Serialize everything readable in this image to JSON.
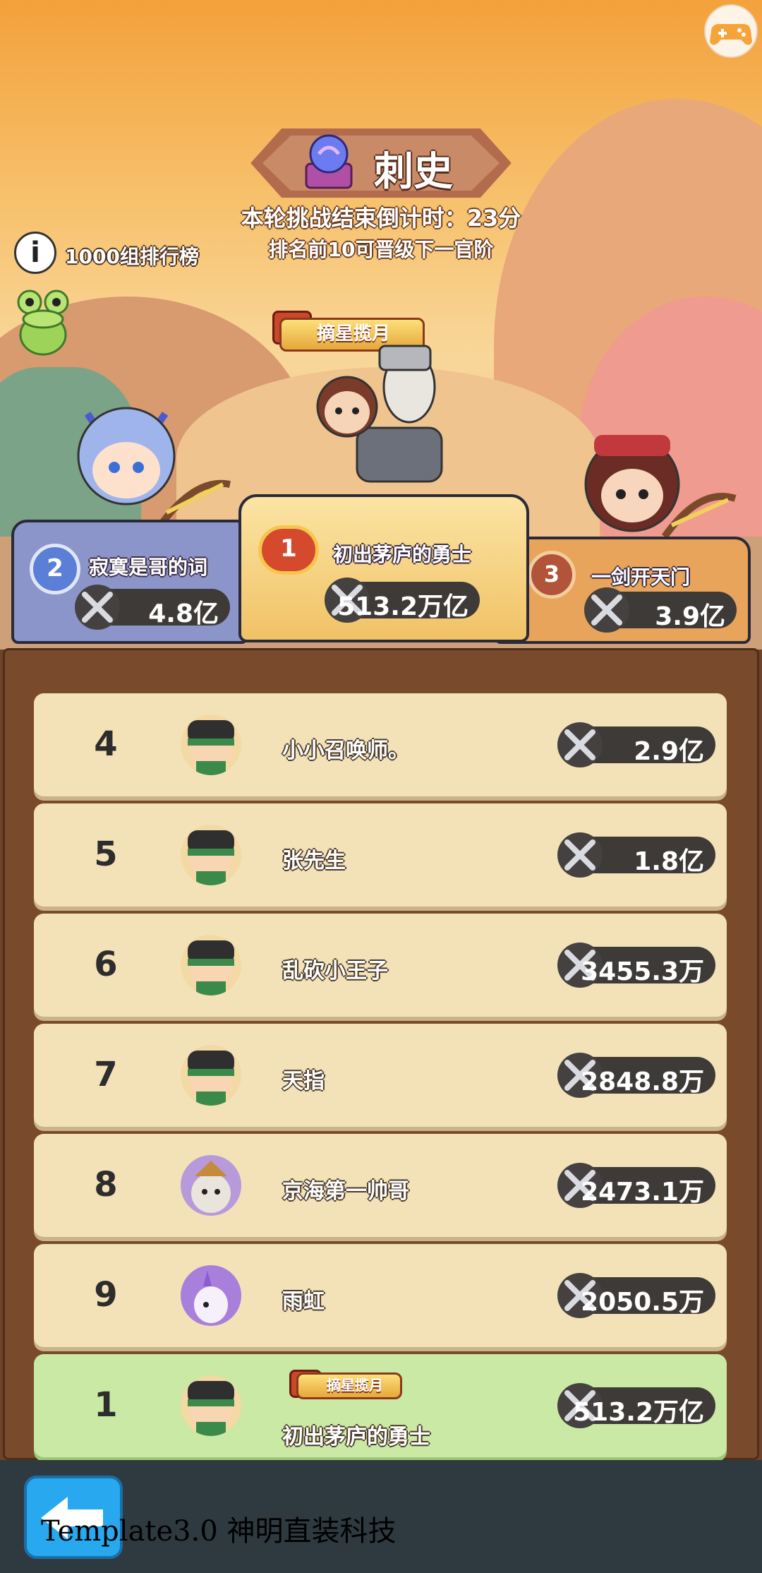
{
  "header": {
    "title": "刺史",
    "countdown": "本轮挑战结束倒计时：23分",
    "promotion_note": "排名前10可晋级下一官阶",
    "info_label": "1000组排行榜"
  },
  "podium": {
    "first": {
      "rank": "1",
      "name": "初出茅庐的勇士",
      "power": "513.2万亿",
      "badge": "摘星揽月"
    },
    "second": {
      "rank": "2",
      "name": "寂寞是哥的词",
      "power": "4.8亿"
    },
    "third": {
      "rank": "3",
      "name": "一剑开天门",
      "power": "3.9亿"
    }
  },
  "rows": [
    {
      "rank": "4",
      "name": "小小召唤师。",
      "power": "2.9亿"
    },
    {
      "rank": "5",
      "name": "张先生",
      "power": "1.8亿"
    },
    {
      "rank": "6",
      "name": "乱砍小王子",
      "power": "3455.3万"
    },
    {
      "rank": "7",
      "name": "天指",
      "power": "2848.8万"
    },
    {
      "rank": "8",
      "name": "京海第一帅哥",
      "power": "2473.1万"
    },
    {
      "rank": "9",
      "name": "雨虹",
      "power": "2050.5万"
    }
  ],
  "my_row": {
    "rank": "1",
    "name": "初出茅庐的勇士",
    "power": "513.2万亿",
    "badge": "摘星揽月"
  },
  "footer": {
    "template_text": "Template3.0 神明直装科技"
  },
  "colors": {
    "row_bg": "#f3e2b8",
    "my_row_bg": "#c9e9a4",
    "board_bg": "#7a4a2c",
    "back_button": "#28a9ef"
  }
}
